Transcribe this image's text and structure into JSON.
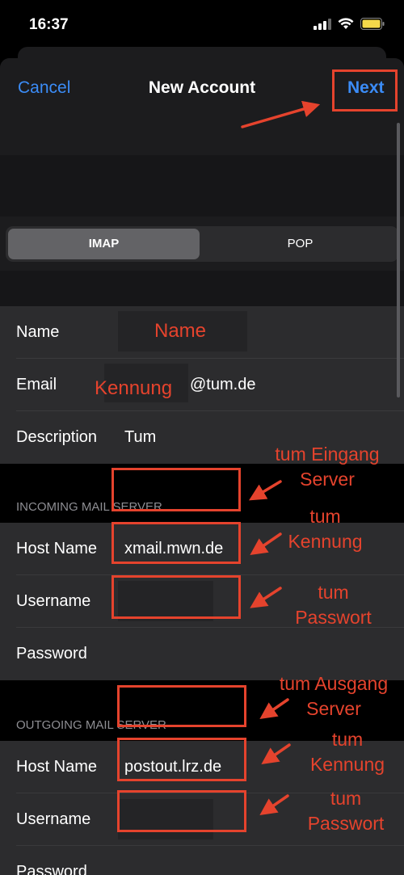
{
  "status": {
    "time": "16:37"
  },
  "nav": {
    "cancel": "Cancel",
    "title": "New Account",
    "next": "Next"
  },
  "segment": {
    "options": [
      "IMAP",
      "POP"
    ],
    "selected": "IMAP"
  },
  "account": {
    "name_label": "Name",
    "name_hint": "Name",
    "email_label": "Email",
    "email_hint": "Kennung",
    "email_suffix": "@tum.de",
    "description_label": "Description",
    "description_value": "Tum"
  },
  "incoming": {
    "header": "INCOMING MAIL SERVER",
    "host_label": "Host Name",
    "host_value": "xmail.mwn.de",
    "username_label": "Username",
    "password_label": "Password"
  },
  "outgoing": {
    "header": "OUTGOING MAIL SERVER",
    "host_label": "Host Name",
    "host_value": "postout.lrz.de",
    "username_label": "Username",
    "password_label": "Password"
  },
  "annotations": {
    "in_host_1": "tum Eingang",
    "in_host_2": "Server",
    "in_user_1": "tum",
    "in_user_2": "Kennung",
    "in_pass_1": "tum",
    "in_pass_2": "Passwort",
    "out_host_1": "tum Ausgang",
    "out_host_2": "Server",
    "out_user_1": "tum",
    "out_user_2": "Kennung",
    "out_pass_1": "tum",
    "out_pass_2": "Passwort"
  },
  "colors": {
    "accent": "#3b8cf7",
    "annotation": "#e5432d"
  },
  "icons": [
    "signal-icon",
    "wifi-icon",
    "battery-icon"
  ]
}
